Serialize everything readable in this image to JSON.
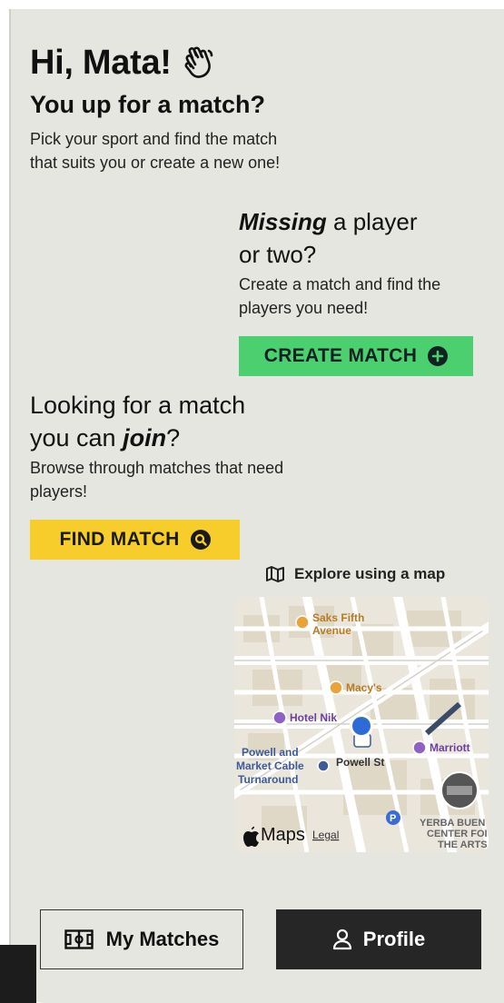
{
  "greeting": {
    "text": "Hi, Mata!",
    "icon": "waving-hand-icon"
  },
  "subtitle": "You up for a match?",
  "intro": "Pick your sport and find the match that suits you or create a new one!",
  "create_section": {
    "title_emphasis": "Missing",
    "title_rest": " a player",
    "title_line2": "or two?",
    "description": "Create a match and find the players you need!",
    "button_label": "CREATE MATCH",
    "button_icon": "plus-circle-icon",
    "button_color": "#4cd06f"
  },
  "join_section": {
    "title_line1": "Looking for a match",
    "title_prefix": "you can ",
    "title_emphasis": "join",
    "title_suffix": "?",
    "description": "Browse through matches that need players!",
    "button_label": "FIND MATCH",
    "button_icon": "search-circle-icon",
    "button_color": "#f6cd2b"
  },
  "map_section": {
    "explore_label": "Explore using a map",
    "explore_icon": "map-icon",
    "labels": {
      "saks_line1": "Saks Fifth",
      "saks_line2": "Avenue",
      "macys": "Macy's",
      "hotel": "Hotel Nik",
      "cable_line1": "Powell and",
      "cable_line2": "Market Cable",
      "cable_line3": "Turnaround",
      "powell_st": "Powell St",
      "marriott": "Marriott",
      "yerba_line1": "YERBA BUEN",
      "yerba_line2": "CENTER FOI",
      "yerba_line3": "THE ARTS",
      "maps_brand": "Maps",
      "legal": "Legal"
    }
  },
  "nav": {
    "my_matches_label": "My Matches",
    "my_matches_icon": "soccer-field-icon",
    "profile_label": "Profile",
    "profile_icon": "person-icon"
  }
}
